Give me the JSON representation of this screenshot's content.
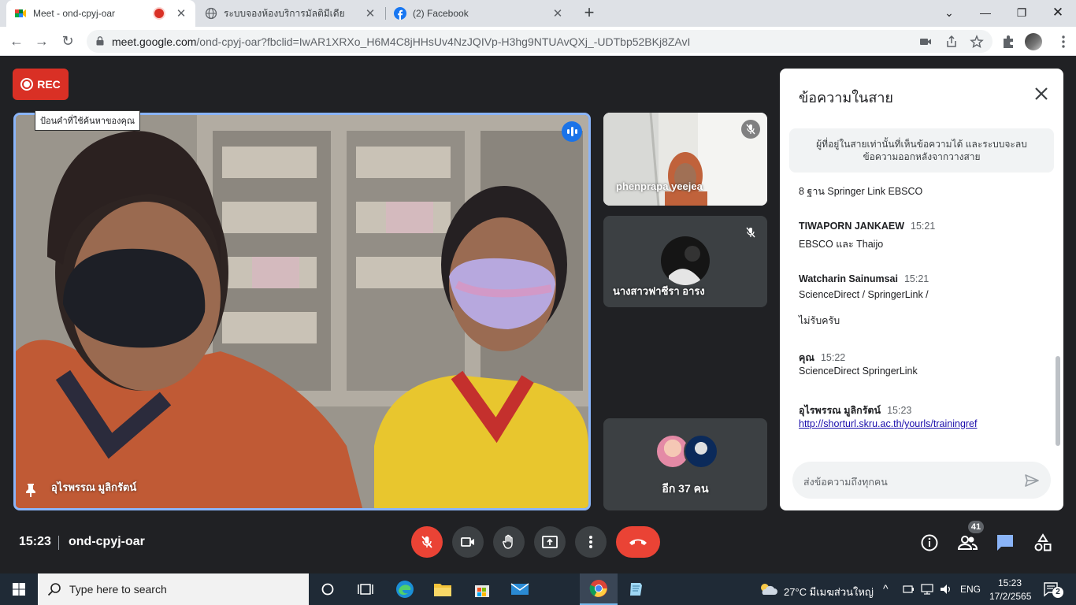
{
  "browser": {
    "tabs": [
      {
        "title": "Meet - ond-cpyj-oar",
        "recording": true,
        "active": true
      },
      {
        "title": "ระบบจองห้องบริการมัลติมีเดีย",
        "active": false
      },
      {
        "title": "(2) Facebook",
        "active": false
      }
    ],
    "url_host": "meet.google.com",
    "url_path": "/ond-cpyj-oar?fbclid=IwAR1XRXo_H6M4C8jHHsUv4NzJQIVp-H3hg9NTUAvQXj_-UDTbp52BKj8ZAvI"
  },
  "meet": {
    "rec_label": "REC",
    "tooltip": "ป้อนคำที่ใช้ค้นหาของคุณ",
    "main_participant": "อุไรพรรณ มูลิกรัตน์",
    "side_tiles": [
      {
        "name": "phenprapa yeejea",
        "muted": true
      },
      {
        "name": "นางสาวฟาซีรา อารง",
        "muted": true
      }
    ],
    "more_participants": "อีก 37 คน",
    "time": "15:23",
    "meeting_code": "ond-cpyj-oar",
    "participant_count": "41",
    "colors": {
      "accent": "#8ab4f8",
      "danger": "#ea4335",
      "rec": "#d93025"
    }
  },
  "chat": {
    "title": "ข้อความในสาย",
    "note": "ผู้ที่อยู่ในสายเท่านั้นที่เห็นข้อความได้ และระบบจะลบข้อความออกหลังจากวางสาย",
    "messages": [
      {
        "text": "8 ฐาน Springer Link   EBSCO"
      },
      {
        "sender": "TIWAPORN JANKAEW",
        "time": "15:21",
        "text": "EBSCO และ Thaijo"
      },
      {
        "sender": "Watcharin Sainumsai",
        "time": "15:21",
        "text": "ScienceDirect / SpringerLink /",
        "text2": "ไม่รับครับ"
      },
      {
        "sender": "คุณ",
        "time": "15:22",
        "text": "ScienceDirect  SpringerLink"
      },
      {
        "sender": "อุไรพรรณ มูลิกรัตน์",
        "time": "15:23",
        "link": "http://shorturl.skru.ac.th/yourls/trainingref"
      }
    ],
    "input_placeholder": "ส่งข้อความถึงทุกคน"
  },
  "taskbar": {
    "search_placeholder": "Type here to search",
    "weather": "27°C  มีเมฆส่วนใหญ่",
    "lang": "ENG",
    "time": "15:23",
    "date": "17/2/2565",
    "notifications": "2"
  }
}
